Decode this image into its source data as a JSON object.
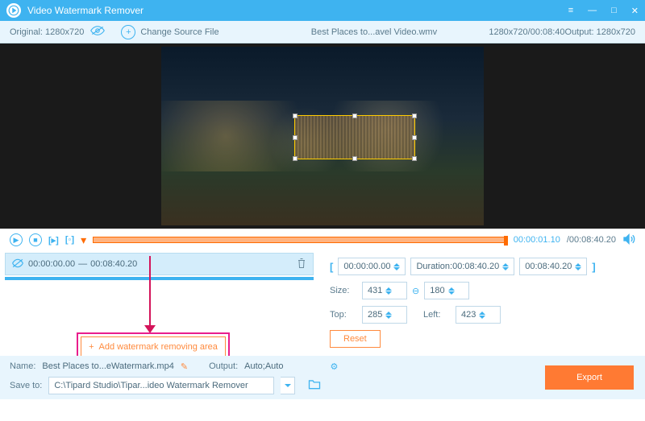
{
  "title": "Video Watermark Remover",
  "toolbar": {
    "original": "Original: 1280x720",
    "change": "Change Source File",
    "filename": "Best Places to...avel Video.wmv",
    "dims": "1280x720/00:08:40",
    "output": "Output: 1280x720"
  },
  "playback": {
    "current": "00:00:01.10",
    "total": "/00:08:40.20"
  },
  "segment": {
    "start": "00:00:00.00",
    "sep": "—",
    "end": "00:08:40.20"
  },
  "controls": {
    "timeStart": "00:00:00.00",
    "durationLbl": "Duration:",
    "duration": "00:08:40.20",
    "timeEnd": "00:08:40.20",
    "sizeLbl": "Size:",
    "sizeW": "431",
    "sizeH": "180",
    "topLbl": "Top:",
    "top": "285",
    "leftLbl": "Left:",
    "left": "423",
    "reset": "Reset"
  },
  "add": {
    "label": "Add watermark removing area"
  },
  "bottom": {
    "nameLbl": "Name:",
    "name": "Best Places to...eWatermark.mp4",
    "outputLbl": "Output:",
    "output": "Auto;Auto",
    "saveLbl": "Save to:",
    "savePath": "C:\\Tipard Studio\\Tipar...ideo Watermark Remover",
    "export": "Export"
  }
}
